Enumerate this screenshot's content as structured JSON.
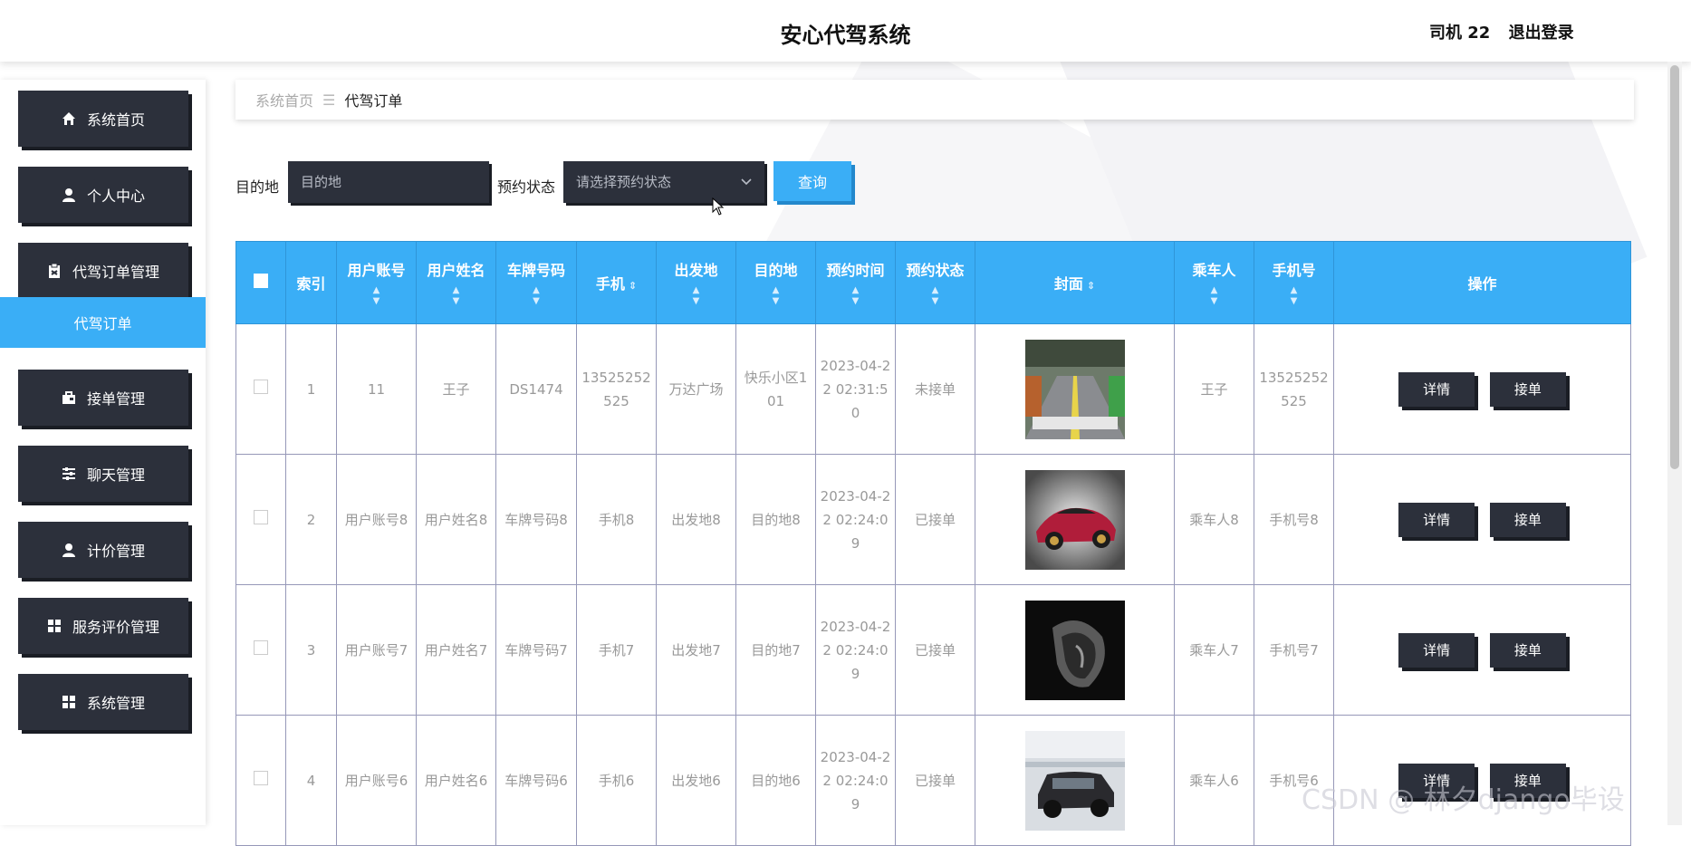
{
  "header": {
    "title": "安心代驾系统",
    "user": "司机 22",
    "logout": "退出登录"
  },
  "sidebar": {
    "items": [
      {
        "label": "系统首页",
        "icon": "home-icon"
      },
      {
        "label": "个人中心",
        "icon": "user-icon"
      },
      {
        "label": "代驾订单管理",
        "icon": "clipboard-icon"
      },
      {
        "label": "代驾订单",
        "icon": "",
        "active": true
      },
      {
        "label": "接单管理",
        "icon": "briefcase-icon"
      },
      {
        "label": "聊天管理",
        "icon": "sliders-icon"
      },
      {
        "label": "计价管理",
        "icon": "user-icon"
      },
      {
        "label": "服务评价管理",
        "icon": "grid-icon"
      },
      {
        "label": "系统管理",
        "icon": "grid-icon"
      }
    ]
  },
  "breadcrumb": {
    "home": "系统首页",
    "current": "代驾订单"
  },
  "search": {
    "dest_label": "目的地",
    "dest_placeholder": "目的地",
    "status_label": "预约状态",
    "status_placeholder": "请选择预约状态",
    "query_button": "查询"
  },
  "table": {
    "headers": [
      "索引",
      "用户账号",
      "用户姓名",
      "车牌号码",
      "手机",
      "出发地",
      "目的地",
      "预约时间",
      "预约状态",
      "封面",
      "乘车人",
      "手机号",
      "操作"
    ],
    "rows": [
      {
        "index": "1",
        "account": "11",
        "name": "王子",
        "plate": "DS1474",
        "phone": "13525252525",
        "from": "万达广场",
        "to": "快乐小区101",
        "time": "2023-04-22 02:31:50",
        "status": "未接单",
        "cover": "parking-garage-photo",
        "passenger": "王子",
        "mobile": "13525252525"
      },
      {
        "index": "2",
        "account": "用户账号8",
        "name": "用户姓名8",
        "plate": "车牌号码8",
        "phone": "手机8",
        "from": "出发地8",
        "to": "目的地8",
        "time": "2023-04-22 02:24:09",
        "status": "已接单",
        "cover": "red-sports-car-photo",
        "passenger": "乘车人8",
        "mobile": "手机号8"
      },
      {
        "index": "3",
        "account": "用户账号7",
        "name": "用户姓名7",
        "plate": "车牌号码7",
        "phone": "手机7",
        "from": "出发地7",
        "to": "目的地7",
        "time": "2023-04-22 02:24:09",
        "status": "已接单",
        "cover": "dark-car-photo",
        "passenger": "乘车人7",
        "mobile": "手机号7"
      },
      {
        "index": "4",
        "account": "用户账号6",
        "name": "用户姓名6",
        "plate": "车牌号码6",
        "phone": "手机6",
        "from": "出发地6",
        "to": "目的地6",
        "time": "2023-04-22 02:24:09",
        "status": "已接单",
        "cover": "suv-showroom-photo",
        "passenger": "乘车人6",
        "mobile": "手机号6"
      }
    ],
    "actions": {
      "detail": "详情",
      "accept": "接单"
    }
  },
  "watermark": "CSDN @ 林夕django毕设",
  "colors": {
    "accent": "#3aaef6",
    "dark": "#2c303b"
  }
}
